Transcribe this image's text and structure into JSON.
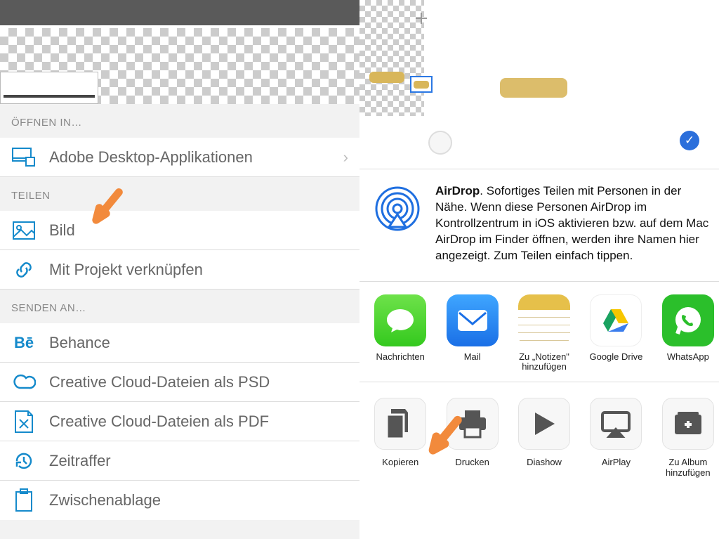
{
  "left": {
    "section_open_in": "ÖFFNEN IN…",
    "adobe_desktop": "Adobe Desktop-Applikationen",
    "section_share": "TEILEN",
    "image": "Bild",
    "link_project": "Mit Projekt verknüpfen",
    "section_send_to": "SENDEN AN…",
    "behance": "Behance",
    "cc_psd": "Creative Cloud-Dateien als PSD",
    "cc_pdf": "Creative Cloud-Dateien als PDF",
    "timelapse": "Zeitraffer",
    "clipboard": "Zwischenablage"
  },
  "right": {
    "airdrop_bold": "AirDrop",
    "airdrop_rest": ". Sofortiges Teilen mit Personen in der Nähe. Wenn diese Personen AirDrop im Kontrollzentrum in iOS aktivieren bzw. auf dem Mac AirDrop im Finder öffnen, werden ihre Namen hier angezeigt. Zum Teilen einfach tippen.",
    "apps": {
      "messages": "Nachrichten",
      "mail": "Mail",
      "notes": "Zu „Notizen\" hinzufügen",
      "drive": "Google Drive",
      "whatsapp": "WhatsApp"
    },
    "actions": {
      "copy": "Kopieren",
      "print": "Drucken",
      "slideshow": "Diashow",
      "airplay": "AirPlay",
      "album": "Zu Album hinzufügen"
    }
  }
}
